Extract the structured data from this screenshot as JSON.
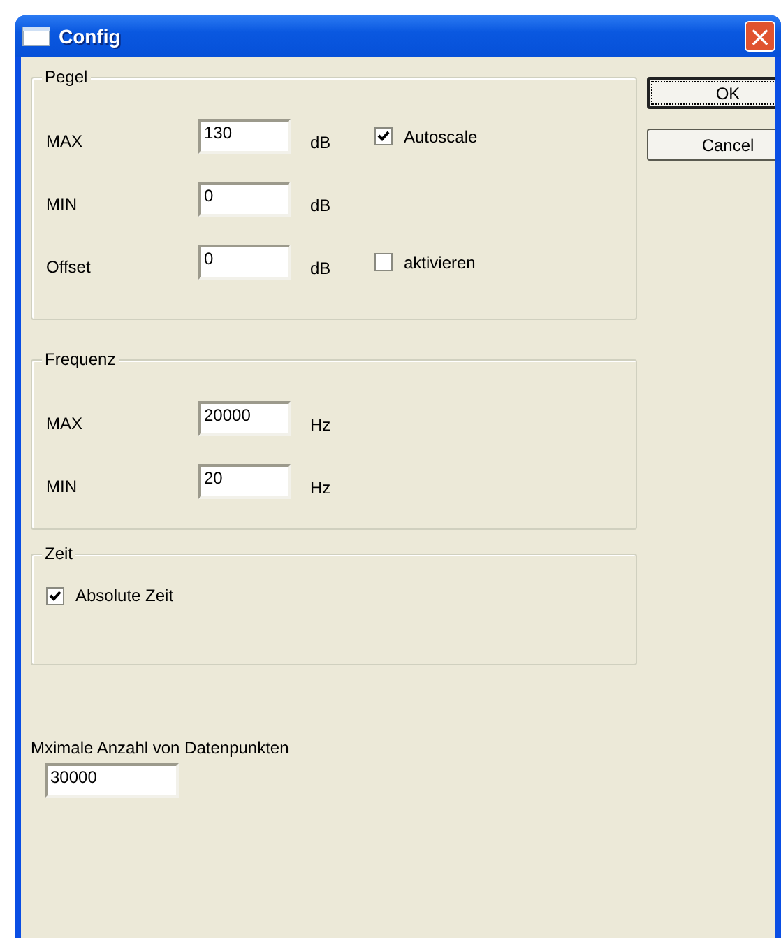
{
  "window": {
    "title": "Config",
    "close": "×"
  },
  "pegel": {
    "title": "Pegel",
    "rows": [
      {
        "label": "MAX",
        "value": "130",
        "unit": "dB",
        "option": {
          "label": "Autoscale",
          "checked": true
        }
      },
      {
        "label": "MIN",
        "value": "0",
        "unit": "dB"
      },
      {
        "label": "Offset",
        "value": "0",
        "unit": "dB",
        "option": {
          "label": "aktivieren",
          "checked": false
        }
      }
    ]
  },
  "frequenz": {
    "title": "Frequenz",
    "rows": [
      {
        "label": "MAX",
        "value": "20000",
        "unit": "Hz"
      },
      {
        "label": "MIN",
        "value": "20",
        "unit": "Hz"
      }
    ]
  },
  "zeit": {
    "title": "Zeit",
    "option": {
      "label": "Absolute Zeit",
      "checked": true
    }
  },
  "datapoints": {
    "label": "Mximale Anzahl von Datenpunkten",
    "value": "30000"
  },
  "buttons": [
    {
      "label": "OK",
      "focused": true
    },
    {
      "label": "Cancel",
      "focused": false
    }
  ]
}
